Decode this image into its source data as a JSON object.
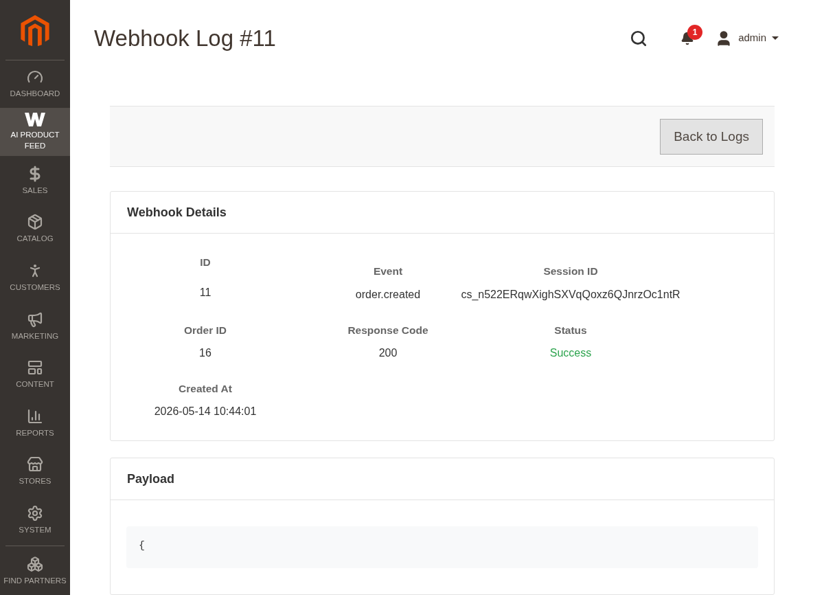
{
  "sidebar": {
    "items": [
      {
        "label": "DASHBOARD",
        "kind": "dashboard",
        "selected": false
      },
      {
        "label": "AI PRODUCT FEED",
        "kind": "feed",
        "selected": true
      },
      {
        "label": "SALES",
        "kind": "sales",
        "selected": false
      },
      {
        "label": "CATALOG",
        "kind": "catalog",
        "selected": false
      },
      {
        "label": "CUSTOMERS",
        "kind": "customers",
        "selected": false
      },
      {
        "label": "MARKETING",
        "kind": "marketing",
        "selected": false
      },
      {
        "label": "CONTENT",
        "kind": "content",
        "selected": false
      },
      {
        "label": "REPORTS",
        "kind": "reports",
        "selected": false
      },
      {
        "label": "STORES",
        "kind": "stores",
        "selected": false
      },
      {
        "label": "SYSTEM",
        "kind": "system",
        "selected": false
      },
      {
        "label": "FIND PARTNERS",
        "kind": "partners",
        "selected": false
      }
    ]
  },
  "page_title": "Webhook Log #11",
  "header": {
    "notifications": "1",
    "user": "admin"
  },
  "actions": {
    "back_button": "Back to Logs"
  },
  "details": {
    "title": "Webhook Details",
    "fields": [
      {
        "label": "ID",
        "value": "11"
      },
      {
        "label": "Event",
        "value": "order.created"
      },
      {
        "label": "Session ID",
        "value": "cs_n522ERqwXighSXVqQoxz6QJnrzOc1ntR"
      },
      {
        "label": "Order ID",
        "value": "16"
      },
      {
        "label": "Response Code",
        "value": "200"
      },
      {
        "label": "Status",
        "value": "Success",
        "kind": "success"
      },
      {
        "label": "Created At",
        "value": "2026-05-14 10:44:01"
      }
    ]
  },
  "payload": {
    "title": "Payload",
    "first_line": "{"
  }
}
